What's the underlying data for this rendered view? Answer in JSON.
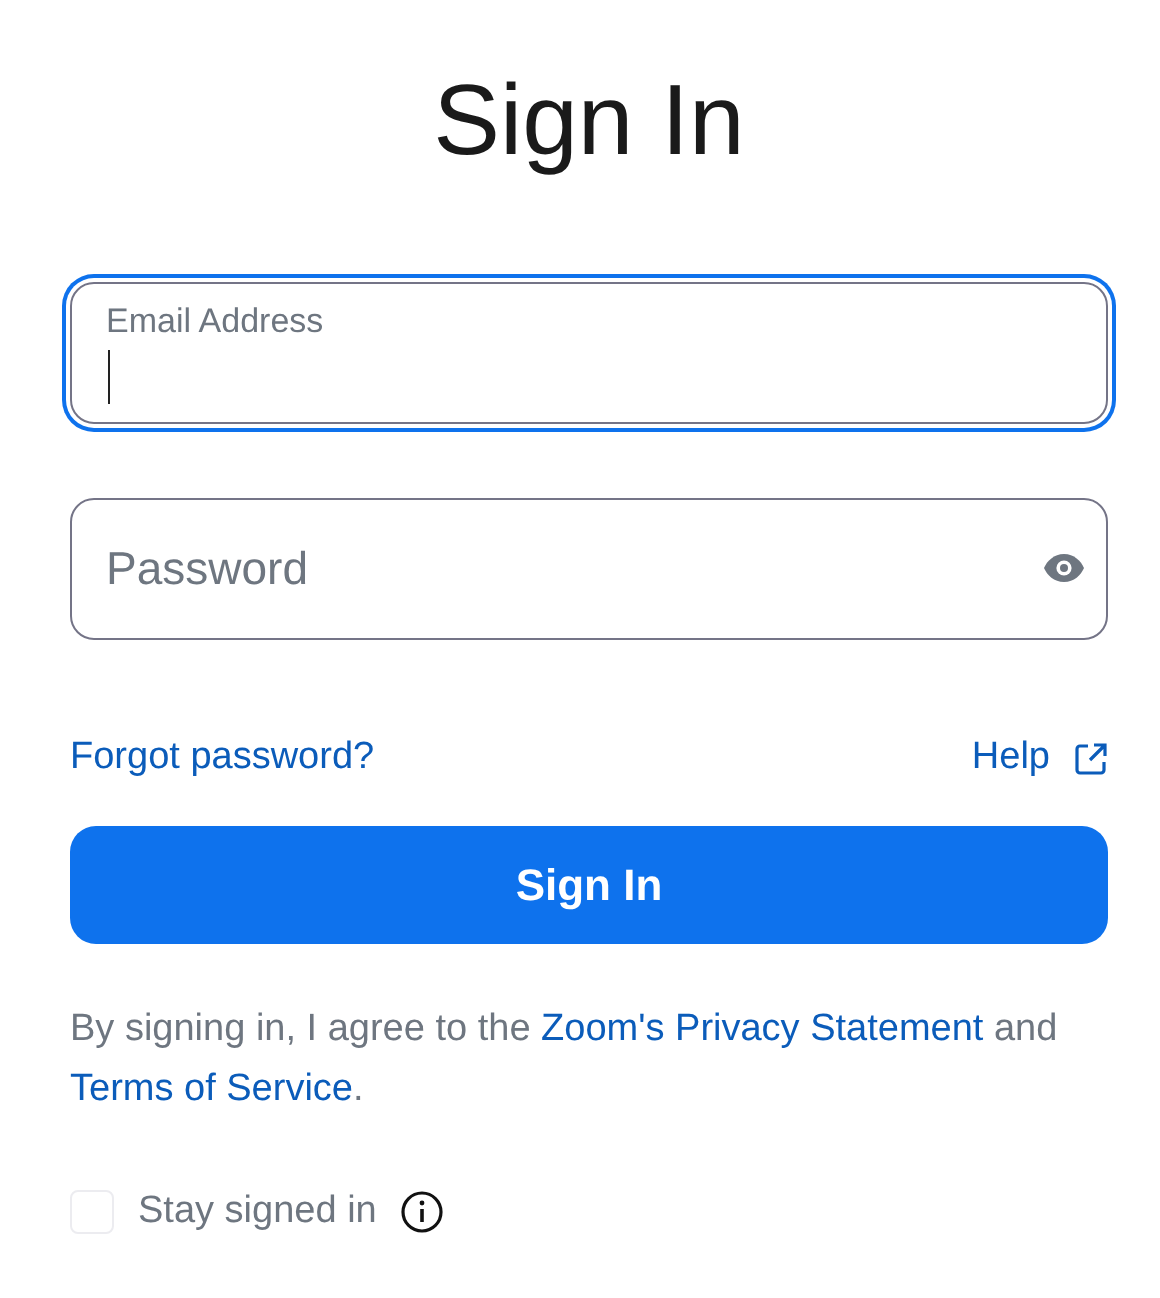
{
  "title": "Sign In",
  "email": {
    "label": "Email Address",
    "focused": true
  },
  "password": {
    "placeholder": "Password"
  },
  "links": {
    "forgot": "Forgot password?",
    "help": "Help"
  },
  "submit": "Sign In",
  "legal": [
    {
      "kind": "text",
      "text": "By signing in, I agree to the "
    },
    {
      "kind": "link",
      "text": "Zoom's Privacy Statement"
    },
    {
      "kind": "text",
      "text": " and "
    },
    {
      "kind": "link",
      "text": "Terms of Service"
    },
    {
      "kind": "text",
      "text": "."
    }
  ],
  "stay_signed_in": {
    "label": "Stay signed in",
    "checked": false
  }
}
